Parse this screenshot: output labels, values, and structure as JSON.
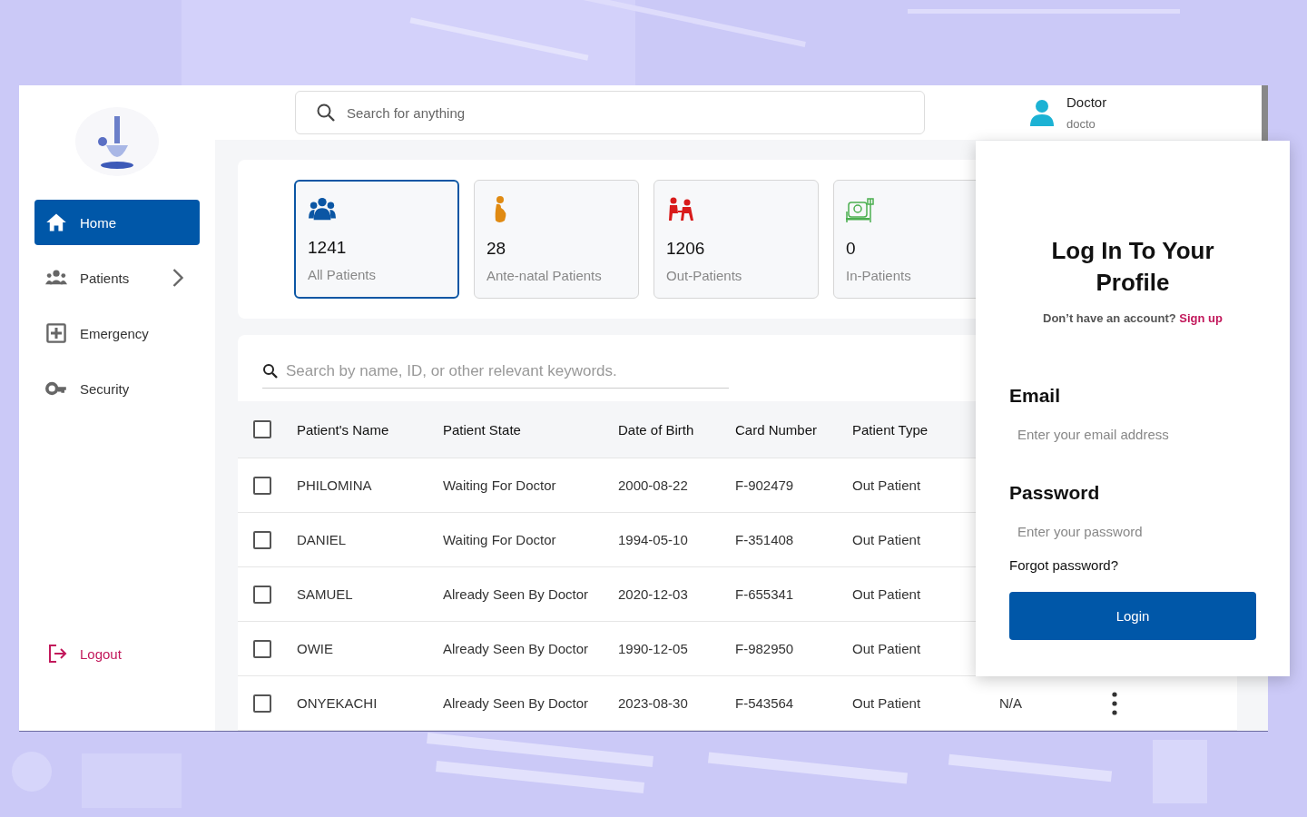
{
  "header": {
    "search": {
      "placeholder": "Search for anything"
    },
    "user": {
      "name": "Doctor",
      "email": "docto"
    }
  },
  "sidebar": {
    "items": [
      {
        "label": "Home",
        "selected": true,
        "has_submenu": false
      },
      {
        "label": "Patients",
        "selected": false,
        "has_submenu": true
      },
      {
        "label": "Emergency",
        "selected": false,
        "has_submenu": false
      },
      {
        "label": "Security",
        "selected": false,
        "has_submenu": false
      }
    ],
    "logout": "Logout"
  },
  "stats": [
    {
      "count": "1241",
      "label": "All Patients",
      "selected": true,
      "color": "#0b56a4"
    },
    {
      "count": "28",
      "label": "Ante-natal Patients",
      "selected": false,
      "color": "#e08a12"
    },
    {
      "count": "1206",
      "label": "Out-Patients",
      "selected": false,
      "color": "#d81b1b"
    },
    {
      "count": "0",
      "label": "In-Patients",
      "selected": false,
      "color": "#4caf50"
    }
  ],
  "table": {
    "search": {
      "placeholder": "Search by name, ID, or other relevant keywords."
    },
    "select_all_checked": false,
    "columns": [
      "Patient's Name",
      "Patient State",
      "Date of Birth",
      "Card Number",
      "Patient Type"
    ],
    "rows": [
      {
        "checked": false,
        "cells": [
          "PHILOMINA",
          "Waiting For Doctor",
          "2000-08-22",
          "F-902479",
          "Out Patient"
        ]
      },
      {
        "checked": false,
        "cells": [
          "DANIEL",
          "Waiting For Doctor",
          "1994-05-10",
          "F-351408",
          "Out Patient"
        ]
      },
      {
        "checked": false,
        "cells": [
          "SAMUEL",
          "Already Seen By Doctor",
          "2020-12-03",
          "F-655341",
          "Out Patient"
        ]
      },
      {
        "checked": false,
        "cells": [
          "OWIE",
          "Already Seen By Doctor",
          "1990-12-05",
          "F-982950",
          "Out Patient"
        ]
      },
      {
        "checked": false,
        "cells": [
          "ONYEKACHI",
          "Already Seen By Doctor",
          "2023-08-30",
          "F-543564",
          "Out Patient",
          "N/A"
        ],
        "has_menu": true
      }
    ]
  },
  "login": {
    "title": "Log In To Your Profile",
    "prompt": "Don’t have an account?",
    "signup_link": "Sign up",
    "email_label": "Email",
    "email_placeholder": "Enter your email address",
    "password_label": "Password",
    "password_placeholder": "Enter your password",
    "forgot_link": "Forgot password?",
    "button": "Login"
  }
}
